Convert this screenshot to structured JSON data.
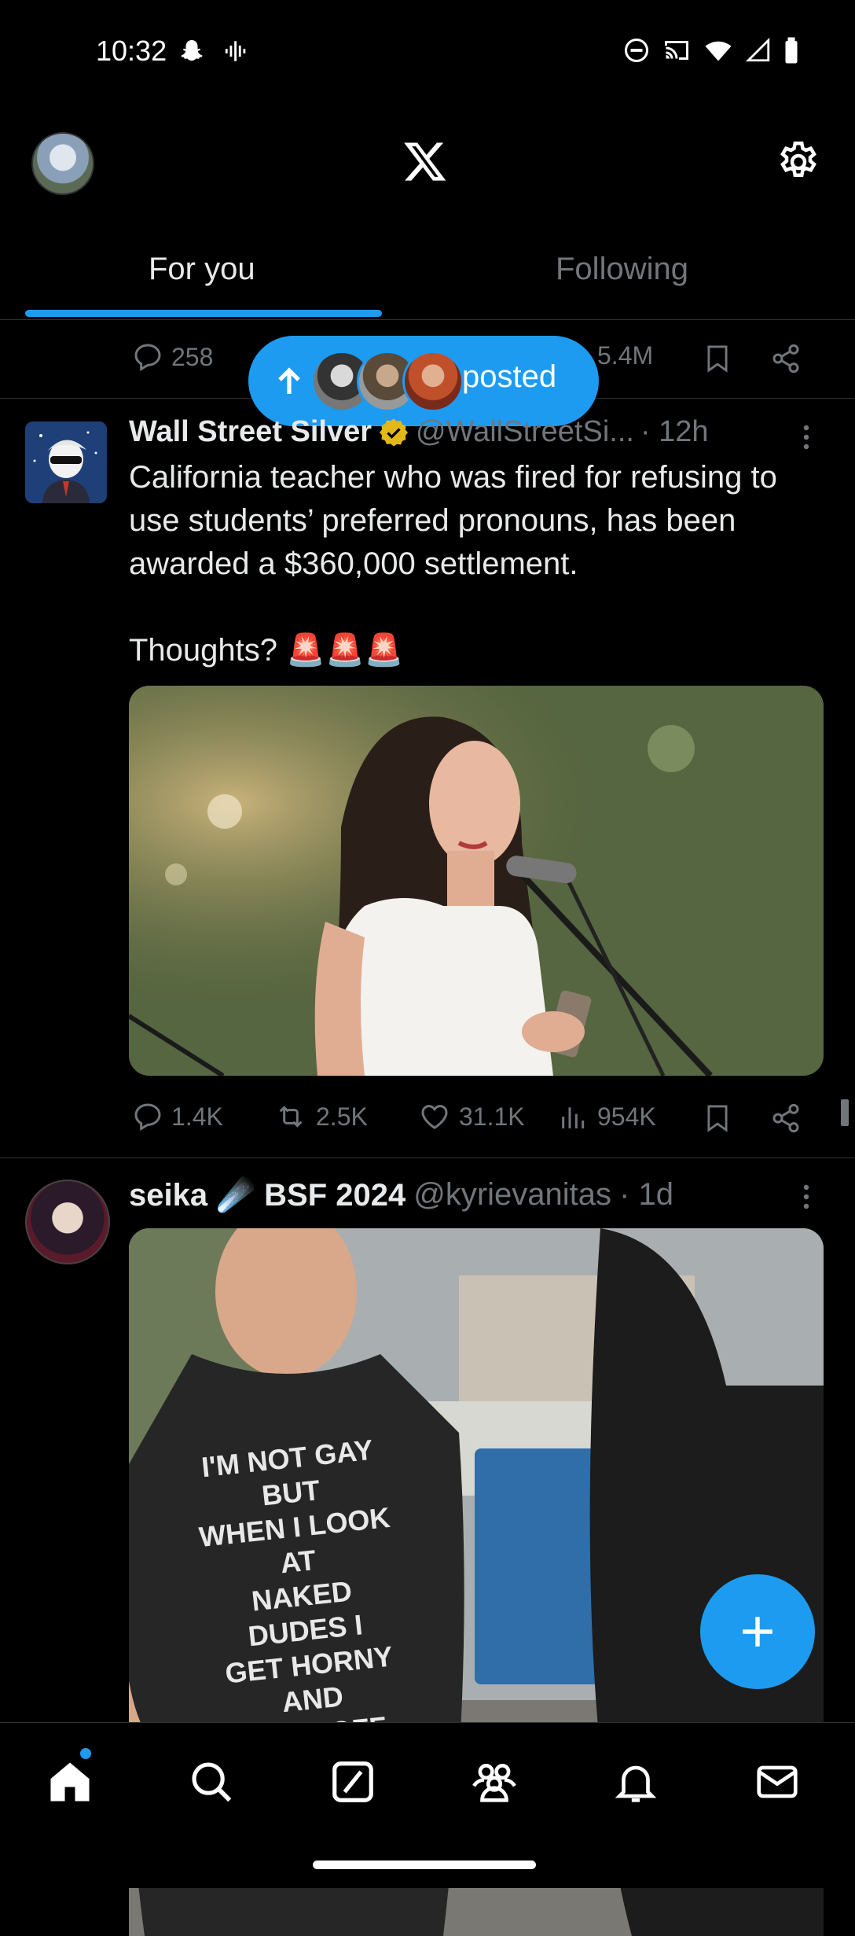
{
  "status_bar": {
    "time": "10:32"
  },
  "header": {
    "logo": "x-logo-icon",
    "settings": "gear-icon"
  },
  "tabs": [
    {
      "label": "For you",
      "selected": true
    },
    {
      "label": "Following",
      "selected": false
    }
  ],
  "prev_tweet_metrics": {
    "replies": "258",
    "views": "5.4M"
  },
  "new_posts_pill": {
    "label": "posted"
  },
  "tweet1": {
    "name": "Wall Street Silver",
    "verified": true,
    "handle": "@WallStreetSi...",
    "time": "· 12h",
    "text": "California teacher who was fired for refusing to use students’ preferred pronouns, has been awarded a $360,000 settlement.\n\nThoughts? 🚨🚨🚨",
    "metrics": {
      "replies": "1.4K",
      "reposts": "2.5K",
      "likes": "31.1K",
      "views": "954K"
    }
  },
  "tweet2": {
    "name": "seika ☄️ BSF 2024",
    "handle": "@kyrievanitas",
    "time": "· 1d",
    "shirt_text": "I'M NOT GAY BUT\nWHEN I LOOK AT\nNAKED DUDES I\nGET HORNY AND\nJACK OFF"
  },
  "fab": {
    "icon": "plus-icon"
  },
  "bottom_nav": [
    {
      "icon": "home-icon",
      "active": true,
      "badge": true
    },
    {
      "icon": "search-icon"
    },
    {
      "icon": "grok-icon"
    },
    {
      "icon": "communities-icon"
    },
    {
      "icon": "bell-icon"
    },
    {
      "icon": "mail-icon"
    }
  ],
  "colors": {
    "accent": "#1d9bf0",
    "background": "#000000",
    "secondary_text": "#71767b",
    "verified_gold": "#e2b719"
  }
}
